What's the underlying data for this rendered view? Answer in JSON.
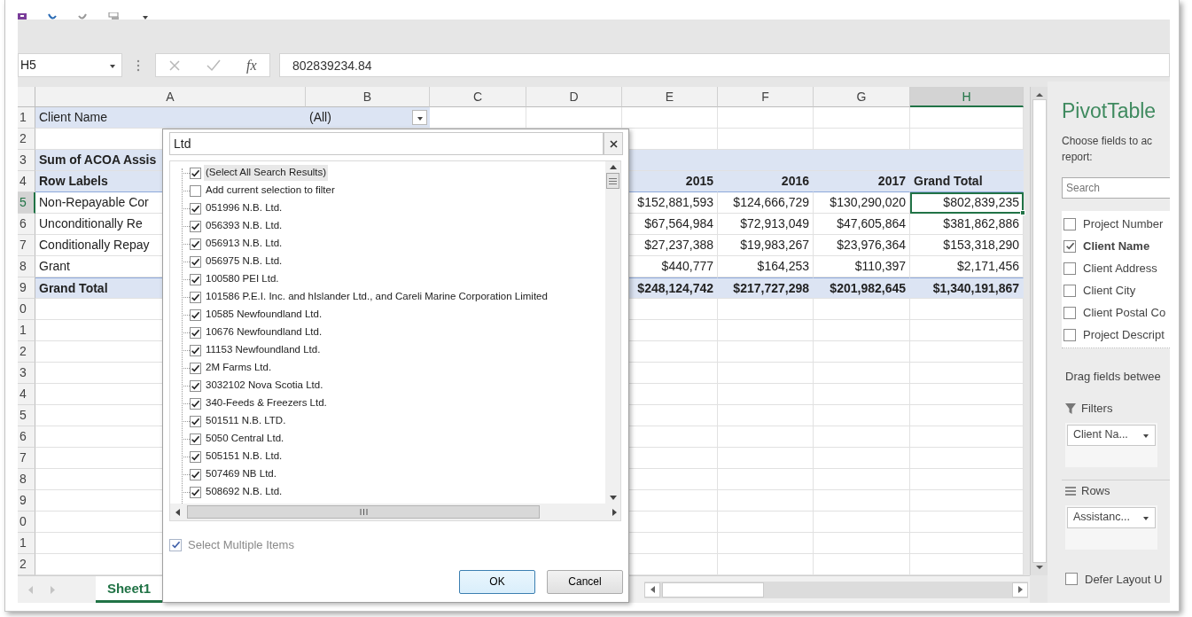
{
  "formula_bar": {
    "name_box": "H5",
    "function_label": "fx",
    "formula": "802839234.84"
  },
  "columns": [
    {
      "label": "A",
      "selected": false
    },
    {
      "label": "B",
      "selected": false
    },
    {
      "label": "C",
      "selected": false
    },
    {
      "label": "D",
      "selected": false
    },
    {
      "label": "E",
      "selected": false
    },
    {
      "label": "F",
      "selected": false
    },
    {
      "label": "G",
      "selected": false
    },
    {
      "label": "H",
      "selected": true
    }
  ],
  "rows": [
    {
      "header": "1",
      "selected": false,
      "kind": "filter",
      "cells": {
        "A": {
          "text": "Client Name",
          "label": true
        },
        "B": {
          "text": "(All)",
          "label": true
        }
      }
    },
    {
      "header": "2",
      "selected": false,
      "kind": "blank",
      "cells": {}
    },
    {
      "header": "3",
      "selected": false,
      "kind": "caption",
      "cells": {
        "A": {
          "text": "Sum of ACOA Assis",
          "label": true
        }
      }
    },
    {
      "header": "4",
      "selected": false,
      "kind": "header",
      "cells": {
        "A": {
          "text": "Row Labels",
          "label": true
        },
        "E": {
          "text": "2015",
          "label": false
        },
        "F": {
          "text": "2016",
          "label": false
        },
        "G": {
          "text": "2017",
          "label": false
        },
        "H": {
          "text": "Grand Total",
          "label": true
        }
      }
    },
    {
      "header": "5",
      "selected": true,
      "kind": "data",
      "cells": {
        "A": {
          "text": "Non-Repayable Cor",
          "label": true
        },
        "E": {
          "text": "$152,881,593",
          "label": false
        },
        "F": {
          "text": "$124,666,729",
          "label": false
        },
        "G": {
          "text": "$130,290,020",
          "label": false
        },
        "H": {
          "text": "$802,839,235",
          "label": false
        }
      }
    },
    {
      "header": "6",
      "selected": false,
      "kind": "data",
      "cells": {
        "A": {
          "text": "Unconditionally Re",
          "label": true
        },
        "E": {
          "text": "$67,564,984",
          "label": false
        },
        "F": {
          "text": "$72,913,049",
          "label": false
        },
        "G": {
          "text": "$47,605,864",
          "label": false
        },
        "H": {
          "text": "$381,862,886",
          "label": false
        }
      }
    },
    {
      "header": "7",
      "selected": false,
      "kind": "data",
      "cells": {
        "A": {
          "text": "Conditionally Repay",
          "label": true
        },
        "E": {
          "text": "$27,237,388",
          "label": false
        },
        "F": {
          "text": "$19,983,267",
          "label": false
        },
        "G": {
          "text": "$23,976,364",
          "label": false
        },
        "H": {
          "text": "$153,318,290",
          "label": false
        }
      }
    },
    {
      "header": "8",
      "selected": false,
      "kind": "data",
      "cells": {
        "A": {
          "text": "Grant",
          "label": true
        },
        "E": {
          "text": "$440,777",
          "label": false
        },
        "F": {
          "text": "$164,253",
          "label": false
        },
        "G": {
          "text": "$110,397",
          "label": false
        },
        "H": {
          "text": "$2,171,456",
          "label": false
        }
      }
    },
    {
      "header": "9",
      "selected": false,
      "kind": "total",
      "cells": {
        "A": {
          "text": "Grand Total",
          "label": true
        },
        "E": {
          "text": "$248,124,742",
          "label": false
        },
        "F": {
          "text": "$217,727,298",
          "label": false
        },
        "G": {
          "text": "$201,982,645",
          "label": false
        },
        "H": {
          "text": "$1,340,191,867",
          "label": false
        }
      }
    },
    {
      "header": "0",
      "selected": false,
      "kind": "blank",
      "cells": {}
    },
    {
      "header": "1",
      "selected": false,
      "kind": "blank",
      "cells": {}
    },
    {
      "header": "2",
      "selected": false,
      "kind": "blank",
      "cells": {}
    },
    {
      "header": "3",
      "selected": false,
      "kind": "blank",
      "cells": {}
    },
    {
      "header": "4",
      "selected": false,
      "kind": "blank",
      "cells": {}
    },
    {
      "header": "5",
      "selected": false,
      "kind": "blank",
      "cells": {}
    },
    {
      "header": "6",
      "selected": false,
      "kind": "blank",
      "cells": {}
    },
    {
      "header": "7",
      "selected": false,
      "kind": "blank",
      "cells": {}
    },
    {
      "header": "8",
      "selected": false,
      "kind": "blank",
      "cells": {}
    },
    {
      "header": "9",
      "selected": false,
      "kind": "blank",
      "cells": {}
    },
    {
      "header": "0",
      "selected": false,
      "kind": "blank",
      "cells": {}
    },
    {
      "header": "1",
      "selected": false,
      "kind": "blank",
      "cells": {}
    },
    {
      "header": "2",
      "selected": false,
      "kind": "blank",
      "cells": {}
    }
  ],
  "sheet_tabs": [
    {
      "label": "Sheet1",
      "selected": true
    }
  ],
  "filter_popup": {
    "search": "Ltd",
    "items": [
      {
        "label": "(Select All Search Results)",
        "checked": true,
        "selected": true
      },
      {
        "label": "Add current selection to filter",
        "checked": false,
        "selected": false
      },
      {
        "label": "051996 N.B. Ltd.",
        "checked": true,
        "selected": false
      },
      {
        "label": "056393 N.B. Ltd.",
        "checked": true,
        "selected": false
      },
      {
        "label": "056913 N.B. Ltd.",
        "checked": true,
        "selected": false
      },
      {
        "label": "056975 N.B. Ltd.",
        "checked": true,
        "selected": false
      },
      {
        "label": "100580 PEI Ltd.",
        "checked": true,
        "selected": false
      },
      {
        "label": "101586 P.E.I. Inc. and hIslander Ltd., and Careli Marine Corporation Limited",
        "checked": true,
        "selected": false
      },
      {
        "label": "10585 Newfoundland Ltd.",
        "checked": true,
        "selected": false
      },
      {
        "label": "10676 Newfoundland Ltd.",
        "checked": true,
        "selected": false
      },
      {
        "label": "11153 Newfoundland Ltd.",
        "checked": true,
        "selected": false
      },
      {
        "label": "2M Farms Ltd.",
        "checked": true,
        "selected": false
      },
      {
        "label": "3032102 Nova Scotia Ltd.",
        "checked": true,
        "selected": false
      },
      {
        "label": "340-Feeds & Freezers Ltd.",
        "checked": true,
        "selected": false
      },
      {
        "label": "501511 N.B. LTD.",
        "checked": true,
        "selected": false
      },
      {
        "label": "5050 Central Ltd.",
        "checked": true,
        "selected": false
      },
      {
        "label": "505151 N.B. Ltd.",
        "checked": true,
        "selected": false
      },
      {
        "label": "507469 NB Ltd.",
        "checked": true,
        "selected": false
      },
      {
        "label": "508692 N.B. Ltd.",
        "checked": true,
        "selected": false
      }
    ],
    "select_multiple": {
      "label": "Select Multiple Items",
      "checked": true,
      "disabled": true
    },
    "buttons": [
      {
        "label": "OK",
        "default": true
      },
      {
        "label": "Cancel",
        "default": false
      }
    ]
  },
  "field_list": {
    "title": "PivotTable",
    "description": "Choose fields to ac\nreport:",
    "search_placeholder": "Search",
    "fields": [
      {
        "label": "Project Number",
        "checked": false
      },
      {
        "label": "Client Name",
        "checked": true
      },
      {
        "label": "Client Address",
        "checked": false
      },
      {
        "label": "Client City",
        "checked": false
      },
      {
        "label": "Client Postal Co",
        "checked": false
      },
      {
        "label": "Project Descript",
        "checked": false
      }
    ],
    "drag_hint": "Drag fields betwee",
    "areas": [
      {
        "kind": "filters",
        "label": "Filters",
        "fields": [
          "Client Na..."
        ]
      },
      {
        "kind": "rows",
        "label": "Rows",
        "fields": [
          "Assistanc..."
        ]
      }
    ],
    "defer": {
      "label": "Defer Layout U",
      "checked": false
    }
  }
}
